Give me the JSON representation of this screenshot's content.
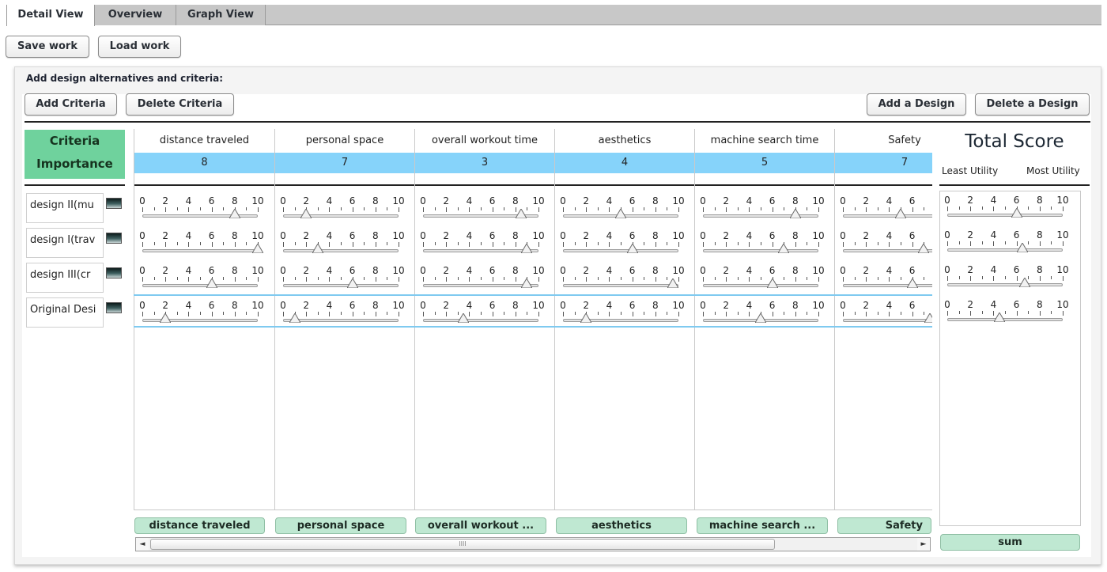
{
  "tabs": [
    {
      "label": "Detail View",
      "active": true
    },
    {
      "label": "Overview",
      "active": false
    },
    {
      "label": "Graph View",
      "active": false
    }
  ],
  "toolbar": {
    "save_label": "Save work",
    "load_label": "Load work"
  },
  "panel": {
    "title": "Add design alternatives and criteria:",
    "add_criteria": "Add Criteria",
    "delete_criteria": "Delete Criteria",
    "add_design": "Add a Design",
    "delete_design": "Delete a Design"
  },
  "criteria_header": {
    "line1": "Criteria",
    "line2": "Importance"
  },
  "criteria": [
    {
      "name": "distance traveled",
      "importance": "8",
      "button": "distance traveled",
      "values": [
        8,
        10,
        6,
        2
      ]
    },
    {
      "name": "personal space",
      "importance": "7",
      "button": "personal space",
      "values": [
        2,
        3,
        6,
        1
      ]
    },
    {
      "name": "overall workout time",
      "importance": "3",
      "button": "overall workout ...",
      "values": [
        8.5,
        9,
        9,
        3.5
      ]
    },
    {
      "name": "aesthetics",
      "importance": "4",
      "button": "aesthetics",
      "values": [
        5,
        6,
        9.5,
        2
      ]
    },
    {
      "name": "machine search time",
      "importance": "5",
      "button": "machine search ...",
      "values": [
        8,
        7,
        6,
        5
      ]
    },
    {
      "name": "Safety",
      "importance": "7",
      "button": "Safety",
      "values": [
        5,
        7,
        6,
        7.5
      ]
    }
  ],
  "designs": [
    "design II(mu",
    "design I(trav",
    "design III(cr",
    "Original Desi"
  ],
  "scale_labels": [
    "0",
    "2",
    "4",
    "6",
    "8",
    "10"
  ],
  "total": {
    "title": "Total Score",
    "least": "Least Utility",
    "most": "Most Utility",
    "values": [
      6,
      6.5,
      6.7,
      4.5
    ],
    "sum_label": "sum"
  },
  "scroll": {
    "grip": "IIII",
    "left": "◄",
    "right": "►"
  },
  "colors": {
    "importance_bg": "#86d3fa",
    "criteria_head_bg": "#6fd29d",
    "column_button_bg": "#bfe8d2",
    "selection_line": "#7fcaf0"
  }
}
